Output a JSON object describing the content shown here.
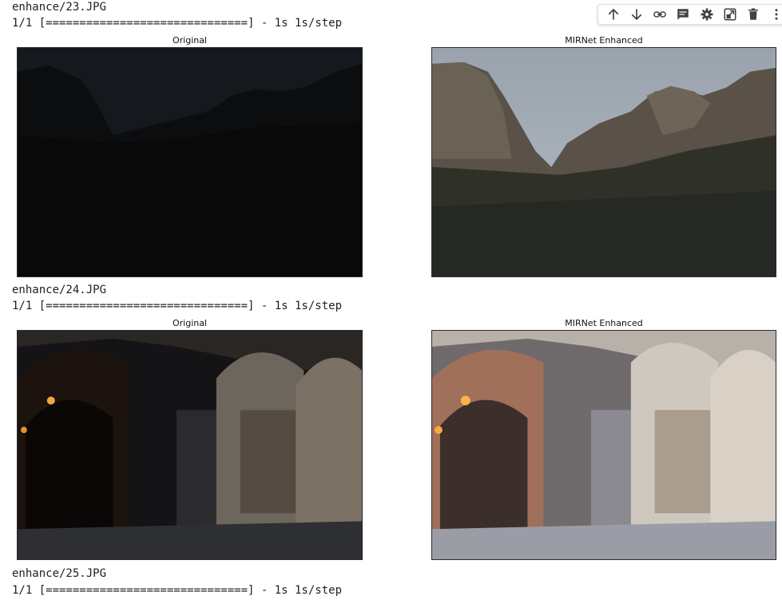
{
  "cells": [
    {
      "filename": "enhance/23.JPG",
      "progress": "1/1 [==============================] - 1s 1s/step",
      "left_title": "Original",
      "right_title": "MIRNet Enhanced",
      "scene": "valley"
    },
    {
      "filename": "enhance/24.JPG",
      "progress": "1/1 [==============================] - 1s 1s/step",
      "left_title": "Original",
      "right_title": "MIRNet Enhanced",
      "scene": "arcade"
    },
    {
      "filename": "enhance/25.JPG",
      "progress": "1/1 [==============================] - 1s 1s/step"
    }
  ],
  "toolbar": {
    "buttons": [
      {
        "name": "move-up-icon"
      },
      {
        "name": "move-down-icon"
      },
      {
        "name": "link-icon"
      },
      {
        "name": "comment-icon"
      },
      {
        "name": "gear-icon"
      },
      {
        "name": "mirror-cell-icon"
      },
      {
        "name": "trash-icon"
      },
      {
        "name": "more-vert-icon"
      }
    ],
    "icon_color": "#424242"
  }
}
